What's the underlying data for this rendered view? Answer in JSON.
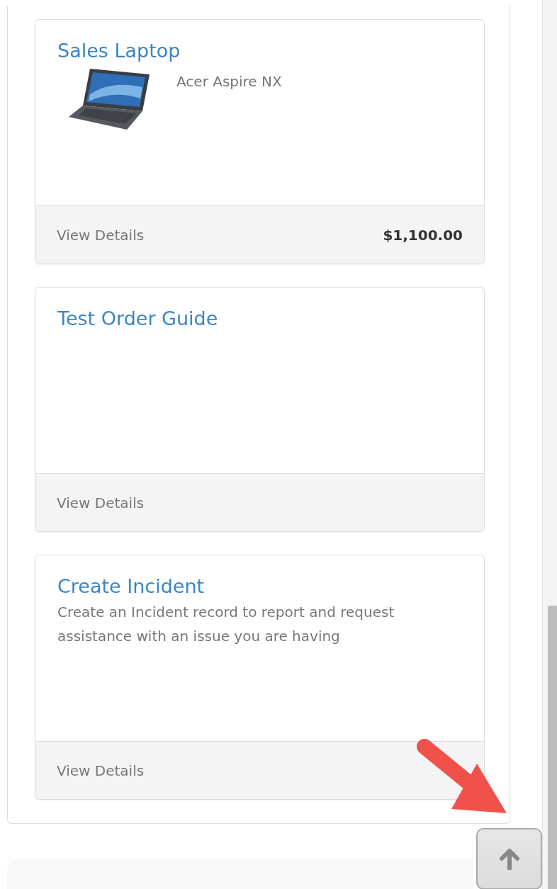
{
  "cards": [
    {
      "kind": "product",
      "title": "Sales Laptop",
      "subtitle": "Acer Aspire NX",
      "link": "View Details",
      "price": "$1,100.00"
    },
    {
      "kind": "item",
      "title": "Test Order Guide",
      "link": "View Details"
    },
    {
      "kind": "item",
      "title": "Create Incident",
      "description": "Create an Incident record to report and request assistance with an issue you are having",
      "link": "View Details"
    }
  ]
}
